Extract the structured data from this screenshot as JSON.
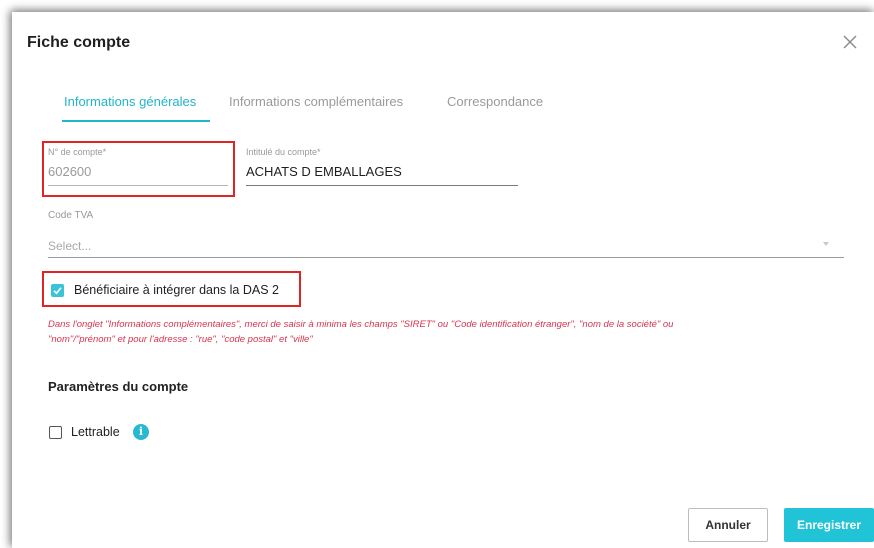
{
  "dialog": {
    "title": "Fiche compte",
    "close_icon": "close-icon"
  },
  "tabs": [
    {
      "label": "Informations générales",
      "active": true
    },
    {
      "label": "Informations complémentaires",
      "active": false
    },
    {
      "label": "Correspondance",
      "active": false
    }
  ],
  "fields": {
    "account_number": {
      "label": "N° de compte",
      "required_mark": "*",
      "value": "602600"
    },
    "account_title": {
      "label": "Intitulé du compte",
      "required_mark": "*",
      "value": "ACHATS D EMBALLAGES"
    },
    "vat_code": {
      "label": "Code TVA",
      "placeholder": "Select..."
    }
  },
  "das2": {
    "label": "Bénéficiaire à intégrer dans la DAS 2",
    "checked": true,
    "warning_line1": "Dans l'onglet \"Informations complémentaires\", merci de saisir à minima les champs \"SIRET\" ou \"Code identification étranger\", \"nom de la société\" ou",
    "warning_line2": "\"nom\"/\"prénom\" et pour l'adresse : \"rue\", \"code postal\" et \"ville\""
  },
  "params": {
    "title": "Paramètres du compte",
    "lettrable_label": "Lettrable",
    "lettrable_checked": false,
    "info_glyph": "i"
  },
  "buttons": {
    "cancel": "Annuler",
    "save": "Enregistrer"
  },
  "colors": {
    "accent": "#21b5c9",
    "primary_button": "#21c4d6",
    "highlight_box": "#e02424",
    "warning_text": "#d9344f"
  }
}
